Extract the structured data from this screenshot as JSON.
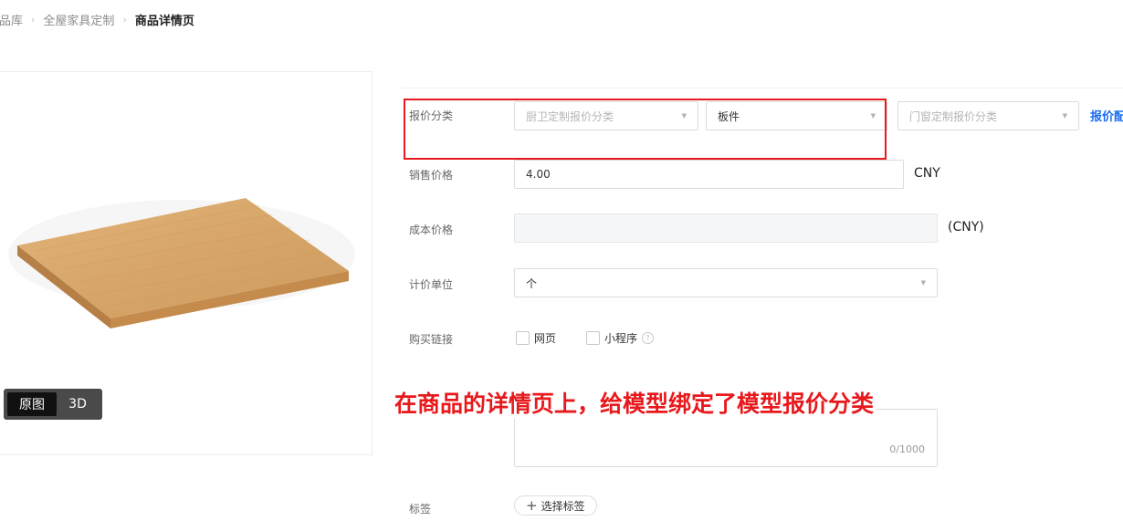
{
  "breadcrumb": {
    "items": [
      "商品库",
      "全屋家具定制"
    ],
    "current": "商品详情页",
    "separator": "›"
  },
  "image_view": {
    "toggle": [
      "原图",
      "3D"
    ],
    "active": "原图"
  },
  "form": {
    "quote_category": {
      "label": "报价分类",
      "kitchen_placeholder": "厨卫定制报价分类",
      "panel_value": "板件",
      "door_window_placeholder": "门窗定制报价分类",
      "config_link": "报价配"
    },
    "sale_price": {
      "label": "销售价格",
      "value": "4.00",
      "unit": "CNY"
    },
    "cost_price": {
      "label": "成本价格",
      "value": "",
      "unit": "(CNY)"
    },
    "pricing_unit": {
      "label": "计价单位",
      "value": "个"
    },
    "purchase_link": {
      "label": "购买链接",
      "web": "网页",
      "miniprogram": "小程序",
      "help": "?"
    },
    "description": {
      "count": "0/1000"
    },
    "tags": {
      "label": "标签",
      "button": "选择标签",
      "plus": "+"
    }
  },
  "annotation": "在商品的详情页上，给模型绑定了模型报价分类",
  "colors": {
    "accent_blue": "#1a6cf0",
    "annotation_red": "#e8191d",
    "wood": "#d9a86a"
  },
  "icons": {
    "dropdown": "caret-down-icon",
    "help": "question-circle-icon",
    "separator": "chevron-right-icon"
  }
}
